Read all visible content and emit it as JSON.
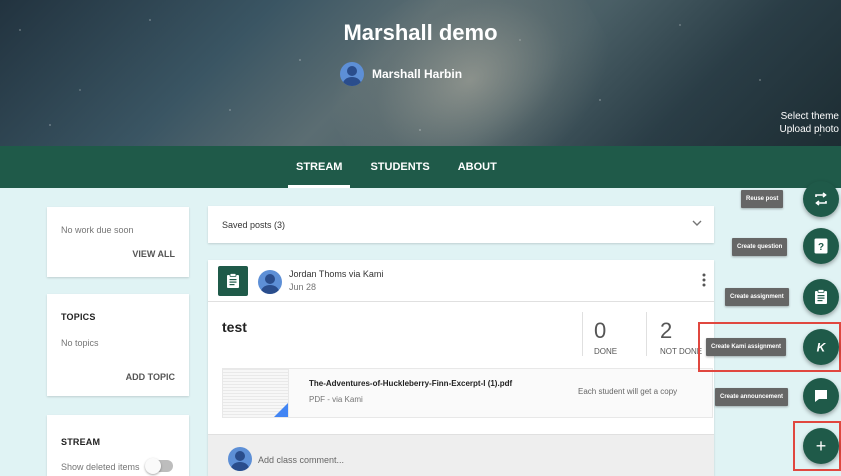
{
  "header": {
    "class_name": "Marshall demo",
    "teacher_name": "Marshall Harbin",
    "theme_links": [
      "Select theme",
      "Upload photo"
    ]
  },
  "nav": {
    "tabs": [
      {
        "label": "STREAM",
        "active": true
      },
      {
        "label": "STUDENTS",
        "active": false
      },
      {
        "label": "ABOUT",
        "active": false
      }
    ]
  },
  "sidebar": {
    "upcoming": {
      "text": "No work due soon",
      "link": "VIEW ALL"
    },
    "topics": {
      "title": "TOPICS",
      "empty_text": "No topics",
      "link": "ADD TOPIC"
    },
    "stream": {
      "title": "STREAM",
      "toggle_label": "Show deleted items",
      "toggle_on": false
    }
  },
  "saved_posts": {
    "label": "Saved posts (3)"
  },
  "post": {
    "author": "Jordan Thoms via Kami",
    "date": "Jun 28",
    "title": "test",
    "done_count": "0",
    "done_label": "DONE",
    "not_done_count": "2",
    "not_done_label": "NOT DONE",
    "attachment": {
      "name": "The-Adventures-of-Huckleberry-Finn-Excerpt-I (1).pdf",
      "source": "PDF - via Kami",
      "permission": "Each student will get a copy"
    },
    "comment_placeholder": "Add class comment..."
  },
  "fab_menu": {
    "reuse": "Reuse post",
    "question": "Create question",
    "assignment": "Create assignment",
    "kami": "Create Kami assignment",
    "announcement": "Create announcement",
    "main": "+"
  },
  "colors": {
    "primary": "#1f5a49",
    "page_bg": "#e0f3f4",
    "highlight": "#e0473f"
  }
}
